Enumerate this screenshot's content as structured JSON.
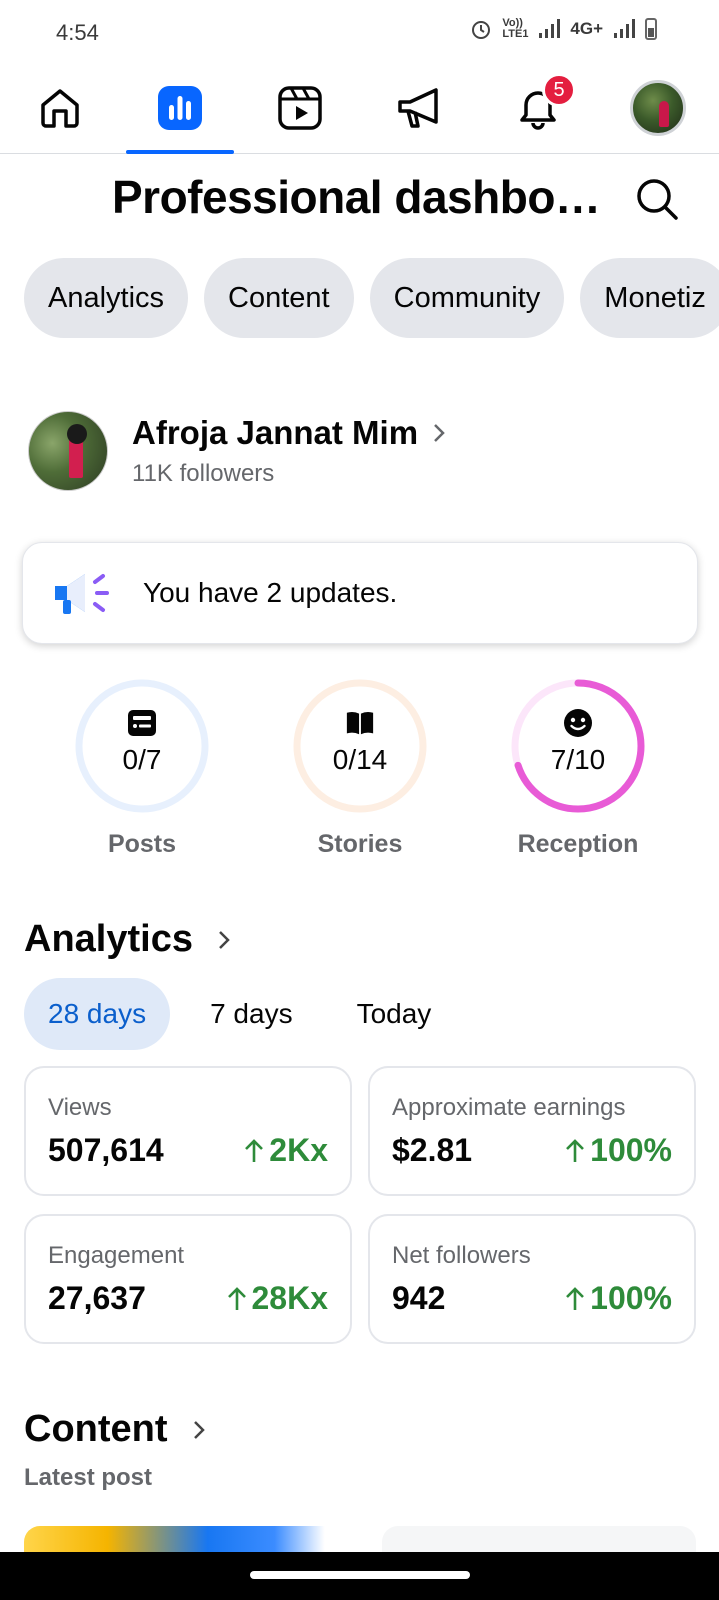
{
  "status_bar": {
    "time": "4:54",
    "network": "4G+",
    "volte": "Vo)) LTE1"
  },
  "top_nav": {
    "items": [
      "home-icon",
      "dashboard-icon",
      "reels-icon",
      "megaphone-icon",
      "bell-icon",
      "profile-avatar"
    ],
    "notification_count": "5",
    "active_item": "dashboard-icon",
    "accent_color": "#0866ff",
    "badge_color": "#e41e3f"
  },
  "header": {
    "title": "Professional dashbo…"
  },
  "chips": [
    "Analytics",
    "Content",
    "Community",
    "Monetiz"
  ],
  "profile": {
    "name": "Afroja Jannat Mim",
    "followers": "11K followers"
  },
  "updates": {
    "text": "You have 2 updates."
  },
  "rings": [
    {
      "label": "Posts",
      "value": "0/7",
      "progress": 0.0,
      "color": "#e7f0fd",
      "icon": "post-icon"
    },
    {
      "label": "Stories",
      "value": "0/14",
      "progress": 0.0,
      "color": "#fdeee2",
      "icon": "book-icon"
    },
    {
      "label": "Reception",
      "value": "7/10",
      "progress": 0.7,
      "color": "#e85bd6",
      "icon": "smiley-icon"
    }
  ],
  "analytics": {
    "title": "Analytics",
    "tabs": [
      "28 days",
      "7 days",
      "Today"
    ],
    "active_tab": "28 days",
    "cards": [
      {
        "label": "Views",
        "value": "507,614",
        "change": "2Kx"
      },
      {
        "label": "Approximate earnings",
        "value": "$2.81",
        "change": "100%"
      },
      {
        "label": "Engagement",
        "value": "27,637",
        "change": "28Kx"
      },
      {
        "label": "Net followers",
        "value": "942",
        "change": "100%"
      }
    ]
  },
  "content": {
    "title": "Content",
    "subtitle": "Latest post"
  }
}
